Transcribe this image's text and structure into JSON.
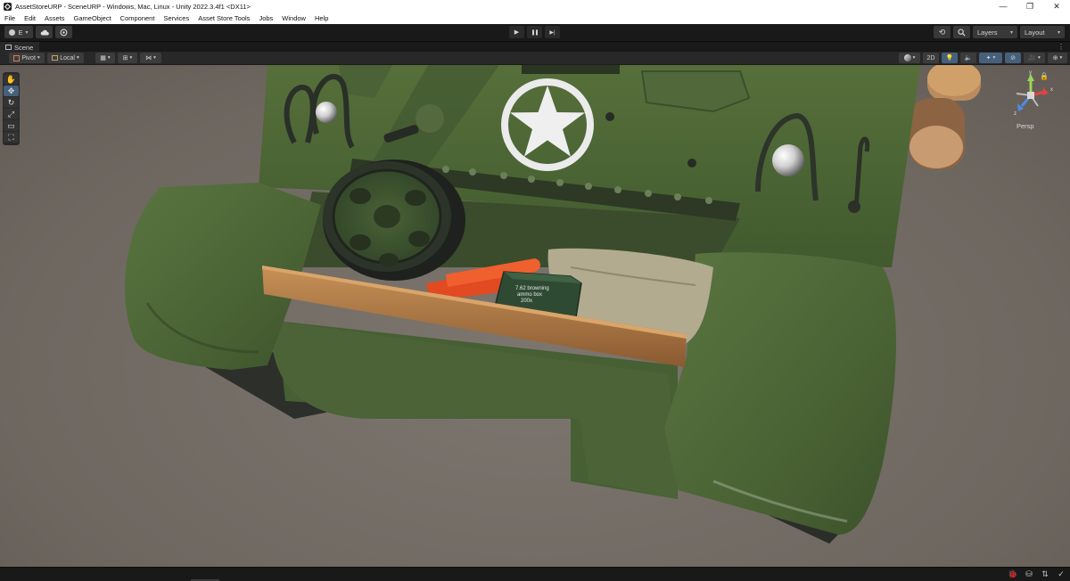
{
  "window": {
    "title": "AssetStoreURP - SceneURP - Windows, Mac, Linux - Unity 2022.3.4f1 <DX11>",
    "controls": {
      "minimize": "—",
      "restore": "❐",
      "close": "✕"
    }
  },
  "menu": [
    "File",
    "Edit",
    "Assets",
    "GameObject",
    "Component",
    "Services",
    "Asset Store Tools",
    "Jobs",
    "Window",
    "Help"
  ],
  "toolbar": {
    "account_label": "E",
    "play_icon": "▶",
    "pause_icon": "❚❚",
    "step_icon": "▶|",
    "layers_label": "Layers",
    "layout_label": "Layout",
    "caret": "▾"
  },
  "scene": {
    "tab_label": "Scene",
    "pivot_label": "Pivot",
    "local_label": "Local",
    "mode_2d_label": "2D",
    "persp_label": "Persp",
    "gizmo_axes": {
      "y": "y",
      "x": "x",
      "z": "z"
    },
    "tools": [
      {
        "name": "hand-tool-icon",
        "glyph": "✋"
      },
      {
        "name": "move-tool-icon",
        "glyph": "✥"
      },
      {
        "name": "rotate-tool-icon",
        "glyph": "↻"
      },
      {
        "name": "scale-tool-icon",
        "glyph": "⤢"
      },
      {
        "name": "rect-tool-icon",
        "glyph": "▭"
      },
      {
        "name": "transform-tool-icon",
        "glyph": "⛶"
      }
    ],
    "ammo_box_label": [
      "7.62 browning",
      "ammo box",
      "200x"
    ]
  },
  "colors": {
    "editor_dark": "#191919",
    "panel": "#282828",
    "accent_blue": "#46607c",
    "sky": "#6e6760",
    "hull_green": "#4f6838",
    "wood": "#b77d45",
    "shell_orange": "#e24a22",
    "ammo_box": "#2f4a33"
  }
}
